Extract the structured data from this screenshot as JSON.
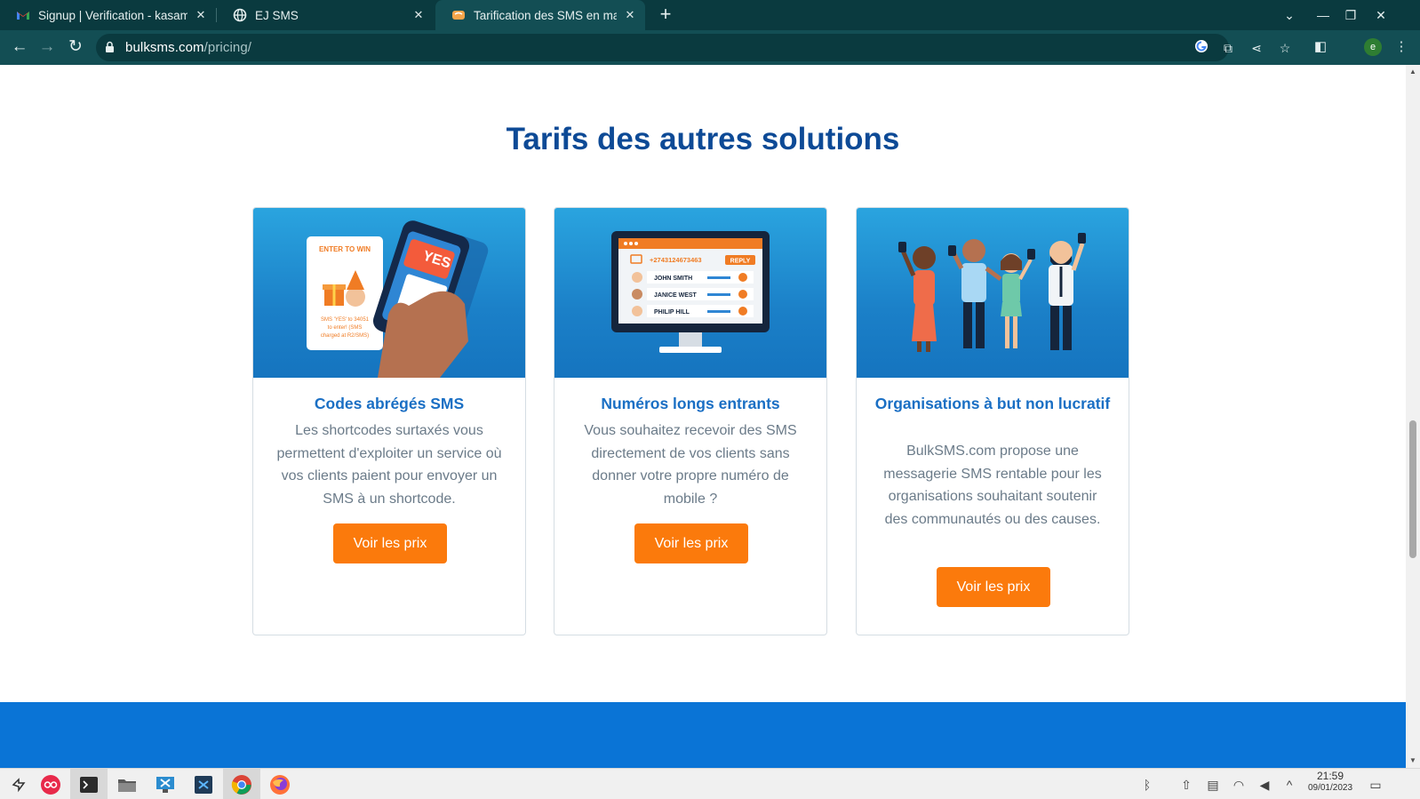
{
  "browser": {
    "tabs": [
      {
        "title": "Signup | Verification - kasam",
        "icon": "gmail-icon",
        "active": false
      },
      {
        "title": "EJ SMS",
        "icon": "globe-icon",
        "active": false
      },
      {
        "title": "Tarification des SMS en masse",
        "icon": "bulksms-icon",
        "active": true
      }
    ],
    "new_tab": "+",
    "address": {
      "host": "bulksms.com",
      "path": "/pricing/"
    },
    "profile_initial": "e"
  },
  "page": {
    "section_title": "Tarifs des autres solutions",
    "cards": [
      {
        "title": "Codes abrégés SMS",
        "description": "Les shortcodes surtaxés vous permettent d'exploiter un service où vos clients paient pour envoyer un SMS à un shortcode.",
        "button": "Voir les prix",
        "illustration": {
          "flyer_heading": "ENTER TO WIN",
          "phone_text": "YES",
          "flyer_line1": "SMS 'YES' to 34051",
          "flyer_line2": "to enter! (SMS",
          "flyer_line3": "charged at R2/SMS)"
        }
      },
      {
        "title": "Numéros longs entrants",
        "description": "Vous souhaitez recevoir des SMS directement de vos clients sans donner votre propre numéro de mobile ?",
        "button": "Voir les prix",
        "illustration": {
          "phone_number": "+2743124673463",
          "reply": "REPLY",
          "contacts": [
            "JOHN SMITH",
            "JANICE WEST",
            "PHILIP HILL"
          ]
        }
      },
      {
        "title": "Organisations à but non lucratif",
        "description": "BulkSMS.com propose une messagerie SMS rentable pour les organisations souhaitant soutenir des communautés ou des causes.",
        "button": "Voir les prix"
      }
    ]
  },
  "taskbar": {
    "time": "21:59",
    "date": "09/01/2023"
  },
  "colors": {
    "title_blue": "#0d4a96",
    "card_title_blue": "#1a6fc4",
    "button_orange": "#fb7a0c",
    "footer_blue": "#0a74d6",
    "chrome_dark": "#0a3a3f",
    "chrome_mid": "#134e54"
  }
}
